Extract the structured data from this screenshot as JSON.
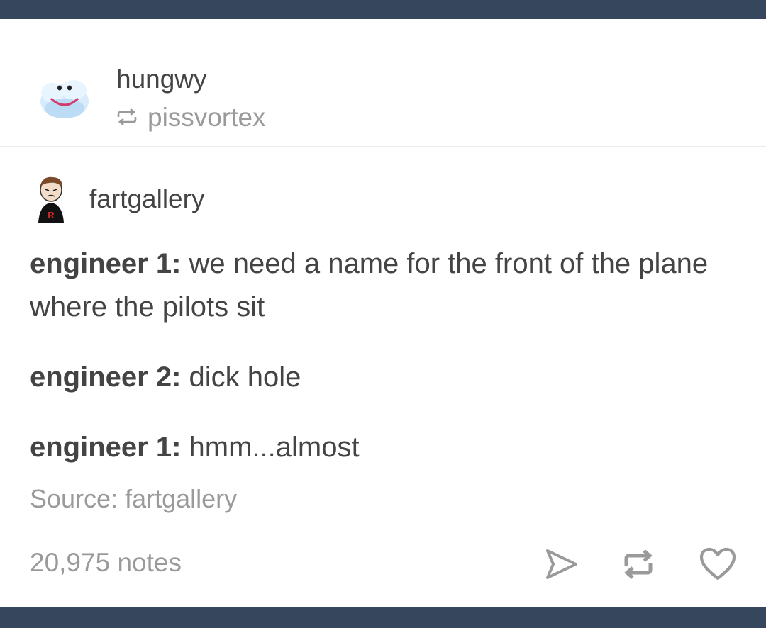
{
  "post": {
    "poster": "hungwy",
    "reblogged_from": "pissvortex",
    "author": "fartgallery",
    "dialogue": [
      {
        "speaker": "engineer 1:",
        "line": " we need a name for the front of the plane where the pilots sit"
      },
      {
        "speaker": "engineer 2:",
        "line": " dick hole"
      },
      {
        "speaker": "engineer 1:",
        "line": " hmm...almost"
      }
    ],
    "source_label": "Source:",
    "source_name": "fartgallery",
    "notes": "20,975 notes"
  },
  "icons": {
    "reblog_small": "reblog-icon",
    "share": "send-icon",
    "reblog": "reblog-icon",
    "like": "heart-icon"
  },
  "colors": {
    "bar": "#36465d",
    "text": "#444444",
    "muted": "#9a9a9a"
  }
}
